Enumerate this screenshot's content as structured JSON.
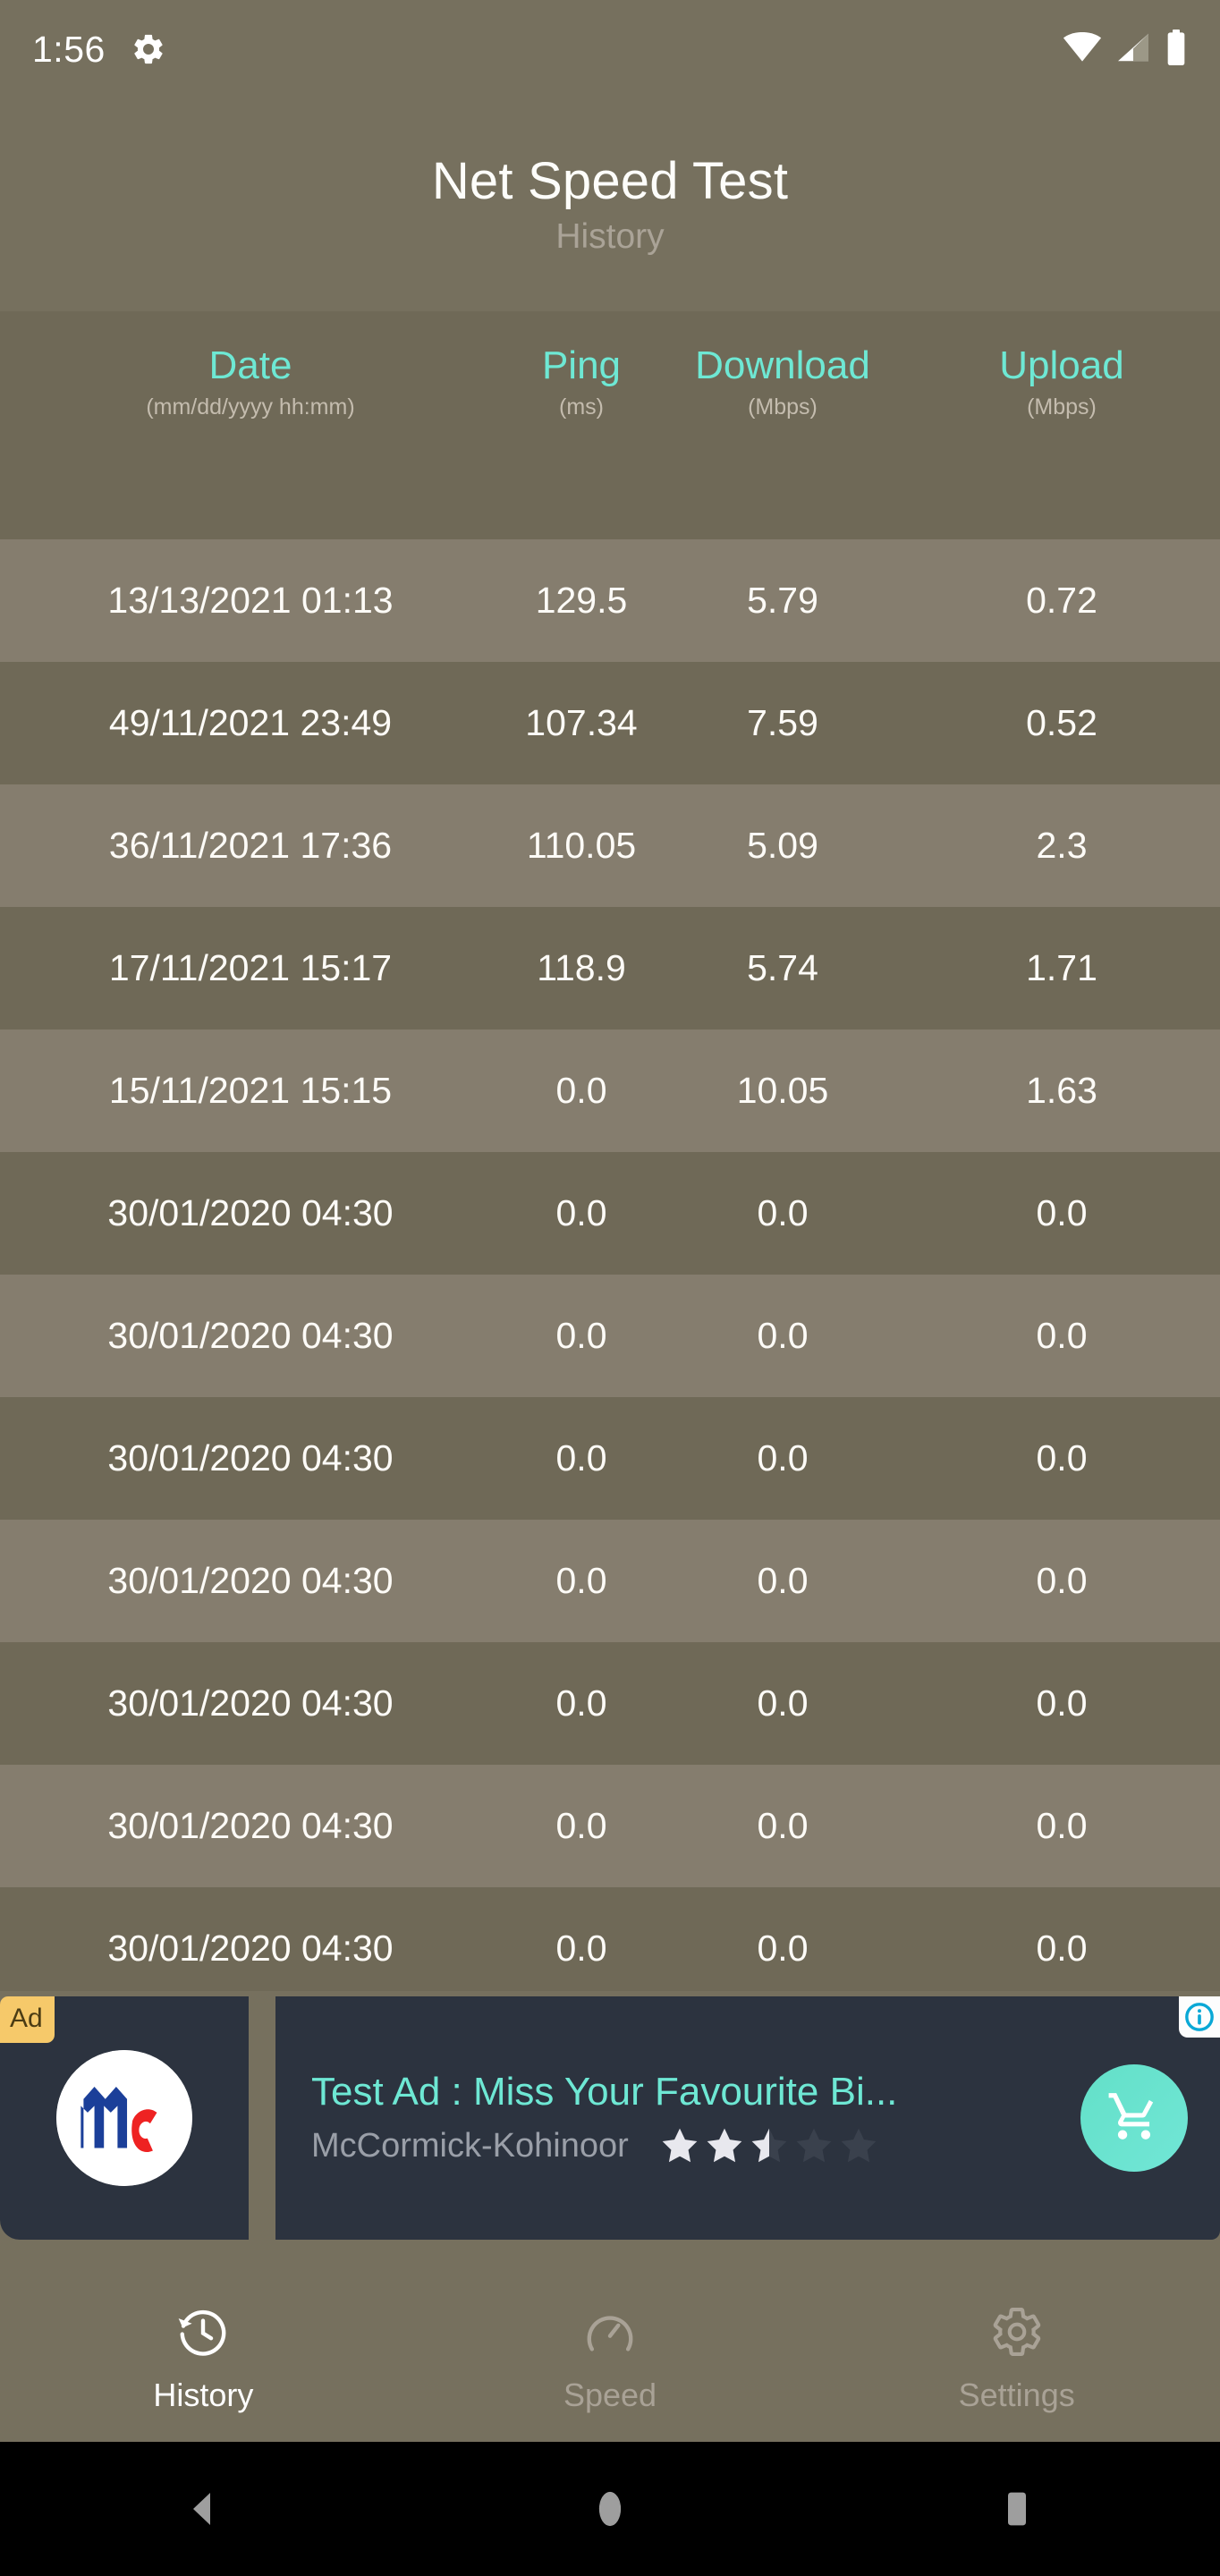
{
  "status_bar": {
    "clock": "1:56",
    "gear_icon": "gear-icon",
    "wifi_icon": "wifi-icon",
    "signal_icon": "cellular-signal-icon",
    "battery_icon": "battery-icon"
  },
  "app_bar": {
    "title": "Net Speed Test",
    "subtitle": "History"
  },
  "table": {
    "columns": [
      {
        "label": "Date",
        "unit": "(mm/dd/yyyy hh:mm)"
      },
      {
        "label": "Ping",
        "unit": "(ms)"
      },
      {
        "label": "Download",
        "unit": "(Mbps)"
      },
      {
        "label": "Upload",
        "unit": "(Mbps)"
      }
    ],
    "rows": [
      {
        "date": "13/13/2021 01:13",
        "ping": "129.5",
        "download": "5.79",
        "upload": "0.72"
      },
      {
        "date": "49/11/2021 23:49",
        "ping": "107.34",
        "download": "7.59",
        "upload": "0.52"
      },
      {
        "date": "36/11/2021 17:36",
        "ping": "110.05",
        "download": "5.09",
        "upload": "2.3"
      },
      {
        "date": "17/11/2021 15:17",
        "ping": "118.9",
        "download": "5.74",
        "upload": "1.71"
      },
      {
        "date": "15/11/2021 15:15",
        "ping": "0.0",
        "download": "10.05",
        "upload": "1.63"
      },
      {
        "date": "30/01/2020 04:30",
        "ping": "0.0",
        "download": "0.0",
        "upload": "0.0"
      },
      {
        "date": "30/01/2020 04:30",
        "ping": "0.0",
        "download": "0.0",
        "upload": "0.0"
      },
      {
        "date": "30/01/2020 04:30",
        "ping": "0.0",
        "download": "0.0",
        "upload": "0.0"
      },
      {
        "date": "30/01/2020 04:30",
        "ping": "0.0",
        "download": "0.0",
        "upload": "0.0"
      },
      {
        "date": "30/01/2020 04:30",
        "ping": "0.0",
        "download": "0.0",
        "upload": "0.0"
      },
      {
        "date": "30/01/2020 04:30",
        "ping": "0.0",
        "download": "0.0",
        "upload": "0.0"
      },
      {
        "date": "30/01/2020 04:30",
        "ping": "0.0",
        "download": "0.0",
        "upload": "0.0"
      }
    ]
  },
  "ad": {
    "badge": "Ad",
    "headline": "Test Ad : Miss Your Favourite Bi...",
    "advertiser": "McCormick-Kohinoor",
    "rating": 2.5,
    "stars_total": 5,
    "cta_icon": "shopping-cart-icon",
    "info_icon": "info-icon",
    "app_icon": "mccormick-logo-icon"
  },
  "bottom_nav": {
    "items": [
      {
        "label": "History",
        "icon": "history-clock-icon",
        "active": true
      },
      {
        "label": "Speed",
        "icon": "speedometer-icon",
        "active": false
      },
      {
        "label": "Settings",
        "icon": "gear-icon",
        "active": false
      }
    ]
  },
  "system_nav": {
    "back": "back-triangle-icon",
    "home": "home-circle-icon",
    "recents": "recents-square-icon"
  },
  "colors": {
    "background": "#76705e",
    "row_odd": "#857d6e",
    "row_even": "#6f6957",
    "accent_teal": "#6ee8d4",
    "ad_card": "#2c333f",
    "ad_badge": "#f6c96a"
  }
}
